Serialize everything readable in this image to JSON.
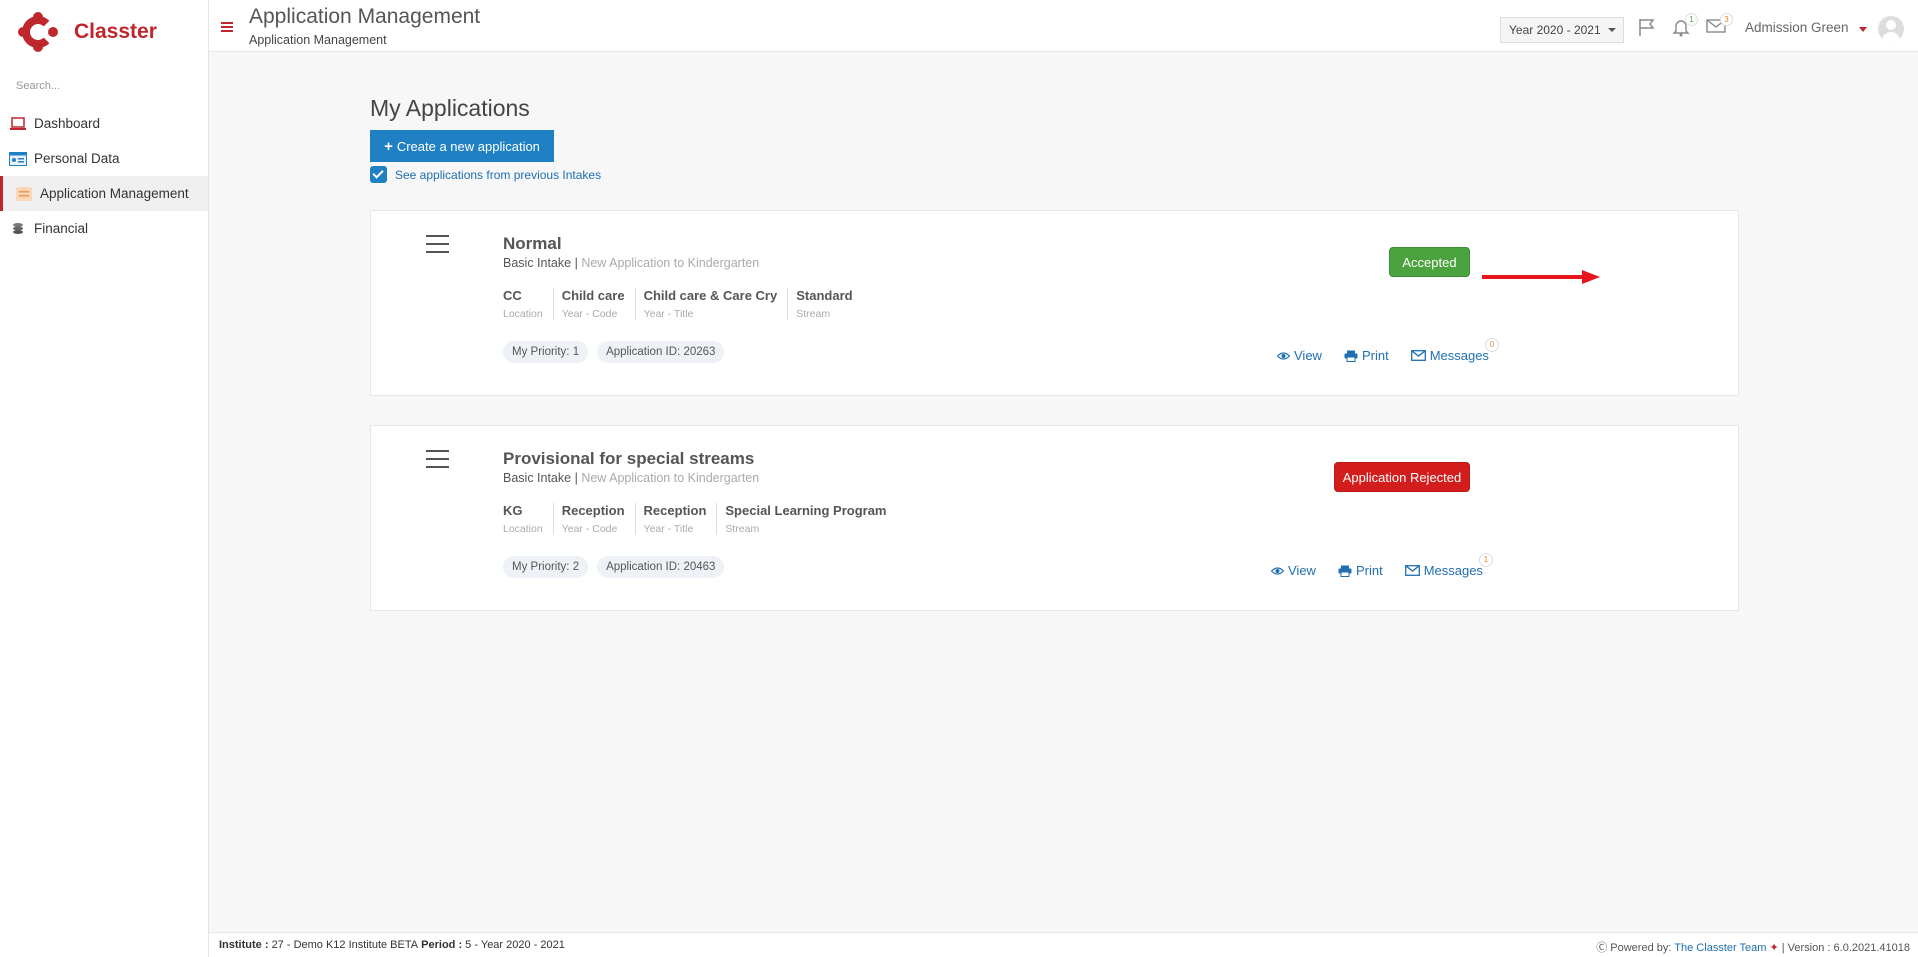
{
  "app": {
    "logo_text": "Classter",
    "brand_color": "#c0262d",
    "accent_color": "#1f81c4"
  },
  "sidebar": {
    "search_placeholder": "Search...",
    "items": [
      {
        "label": "Dashboard",
        "icon": "laptop-icon"
      },
      {
        "label": "Personal Data",
        "icon": "id-card-icon"
      },
      {
        "label": "Application Management",
        "icon": "application-icon",
        "active": true
      },
      {
        "label": "Financial",
        "icon": "coins-icon"
      }
    ]
  },
  "header": {
    "title": "Application Management",
    "subtitle": "Application Management",
    "year_select": "Year 2020 - 2021",
    "notifications_count": "1",
    "messages_count": "3",
    "user_name": "Admission Green"
  },
  "main": {
    "heading": "My Applications",
    "create_button": "Create a new application",
    "see_previous_label": "See applications from previous Intakes",
    "see_previous_checked": true,
    "applications": [
      {
        "title": "Normal",
        "intake": "Basic Intake",
        "separator": "|",
        "type": "New Application to Kindergarten",
        "fields": [
          {
            "value": "CC",
            "label": "Location"
          },
          {
            "value": "Child care",
            "label": "Year - Code"
          },
          {
            "value": "Child care & Care Cry",
            "label": "Year - Title"
          },
          {
            "value": "Standard",
            "label": "Stream"
          }
        ],
        "priority": "My Priority: 1",
        "app_id": "Application ID: 20263",
        "status": "Accepted",
        "status_color": "#4aa33e",
        "view": "View",
        "print": "Print",
        "messages": "Messages",
        "messages_count": "0"
      },
      {
        "title": "Provisional for special streams",
        "intake": "Basic Intake",
        "separator": "|",
        "type": "New Application to Kindergarten",
        "fields": [
          {
            "value": "KG",
            "label": "Location"
          },
          {
            "value": "Reception",
            "label": "Year - Code"
          },
          {
            "value": "Reception",
            "label": "Year - Title"
          },
          {
            "value": "Special Learning Program",
            "label": "Stream"
          }
        ],
        "priority": "My Priority: 2",
        "app_id": "Application ID: 20463",
        "status": "Application Rejected",
        "status_color": "#d31d1d",
        "view": "View",
        "print": "Print",
        "messages": "Messages",
        "messages_count": "1"
      }
    ]
  },
  "footer": {
    "institute_label": "Institute :",
    "institute_value": "27 - Demo K12 Institute BETA",
    "period_label": "Period :",
    "period_value": "5 - Year 2020 - 2021",
    "powered_by": "Powered by:",
    "team_link": "The Classter Team",
    "version": "| Version : 6.0.2021.41018"
  }
}
